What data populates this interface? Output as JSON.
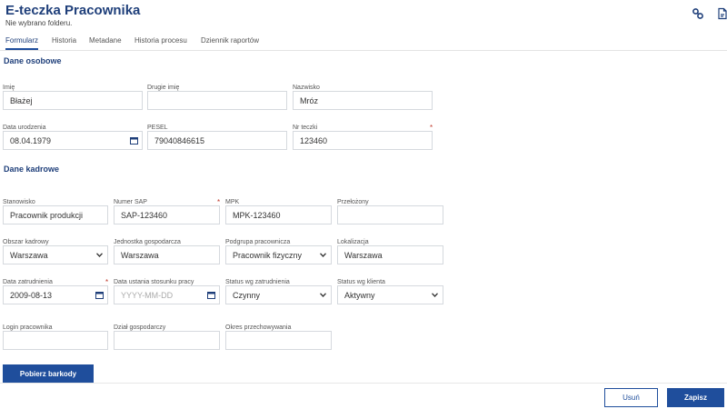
{
  "header": {
    "title": "E-teczka Pracownika",
    "subtitle": "Nie wybrano folderu."
  },
  "icons": {
    "link": "link-icon",
    "document": "document-icon"
  },
  "tabs": [
    {
      "label": "Formularz",
      "active": true
    },
    {
      "label": "Historia",
      "active": false
    },
    {
      "label": "Metadane",
      "active": false
    },
    {
      "label": "Historia procesu",
      "active": false
    },
    {
      "label": "Dziennik raportów",
      "active": false
    }
  ],
  "personal": {
    "heading": "Dane osobowe",
    "imie": {
      "label": "Imię",
      "value": "Błażej"
    },
    "drugie_imie": {
      "label": "Drugie imię",
      "value": ""
    },
    "nazwisko": {
      "label": "Nazwisko",
      "value": "Mróz"
    },
    "data_urodzenia": {
      "label": "Data urodzenia",
      "value": "08.04.1979"
    },
    "pesel": {
      "label": "PESEL",
      "value": "79040846615"
    },
    "nr_teczki": {
      "label": "Nr teczki",
      "value": "123460",
      "required_mark": "*"
    }
  },
  "hr": {
    "heading": "Dane kadrowe",
    "stanowisko": {
      "label": "Stanowisko",
      "value": "Pracownik produkcji"
    },
    "numer_sap": {
      "label": "Numer SAP",
      "value": "SAP-123460",
      "required_mark": "*"
    },
    "mpk": {
      "label": "MPK",
      "value": "MPK-123460"
    },
    "przelozony": {
      "label": "Przełożony",
      "value": ""
    },
    "obszar_kadrowy": {
      "label": "Obszar kadrowy",
      "value": "Warszawa"
    },
    "jednostka": {
      "label": "Jednostka gospodarcza",
      "value": "Warszawa"
    },
    "podgrupa": {
      "label": "Podgrupa pracownicza",
      "value": "Pracownik fizyczny"
    },
    "lokalizacja": {
      "label": "Lokalizacja",
      "value": "Warszawa"
    },
    "data_zatrudnienia": {
      "label": "Data zatrudnienia",
      "value": "2009-08-13",
      "required_mark": "*"
    },
    "data_ustania": {
      "label": "Data ustania stosunku pracy",
      "value": "",
      "placeholder": "YYYY-MM-DD"
    },
    "status_zatrudnienia": {
      "label": "Status wg zatrudnienia",
      "value": "Czynny"
    },
    "status_klienta": {
      "label": "Status wg klienta",
      "value": "Aktywny"
    },
    "login": {
      "label": "Login pracownika",
      "value": ""
    },
    "dzial": {
      "label": "Dział gospodarczy",
      "value": ""
    },
    "okres": {
      "label": "Okres przechowywania",
      "value": ""
    }
  },
  "buttons": {
    "barcode": "Pobierz barkody",
    "delete": "Usuń",
    "save": "Zapisz"
  }
}
